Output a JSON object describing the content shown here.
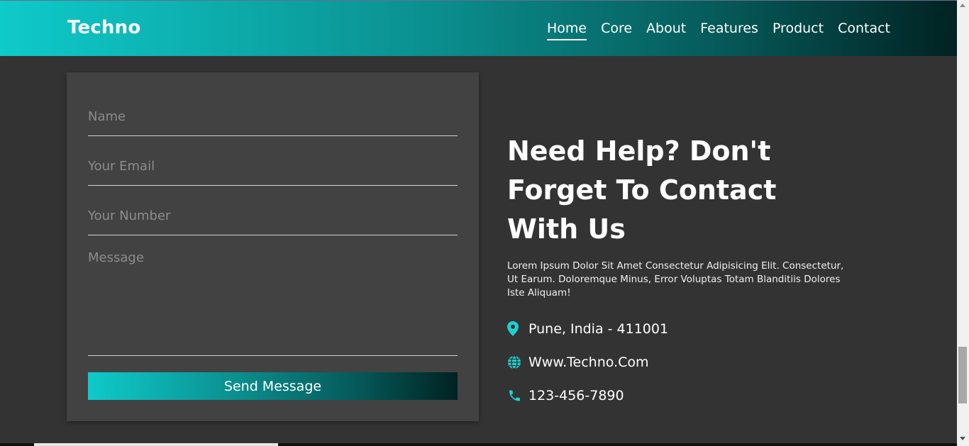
{
  "brand": "Techno",
  "nav": {
    "items": [
      {
        "label": "Home",
        "active": true
      },
      {
        "label": "Core",
        "active": false
      },
      {
        "label": "About",
        "active": false
      },
      {
        "label": "Features",
        "active": false
      },
      {
        "label": "Product",
        "active": false
      },
      {
        "label": "Contact",
        "active": false
      }
    ]
  },
  "form": {
    "name_placeholder": "Name",
    "email_placeholder": "Your Email",
    "number_placeholder": "Your Number",
    "message_placeholder": "Message",
    "name_value": "",
    "email_value": "",
    "number_value": "",
    "message_value": "",
    "send_label": "Send Message"
  },
  "info": {
    "title": "Need Help? Don't Forget To Contact With Us",
    "description": "Lorem Ipsum Dolor Sit Amet Consectetur Adipisicing Elit. Consectetur, Ut Earum. Doloremque Minus, Error Voluptas Totam Blanditiis Dolores Iste Aliquam!",
    "contacts": [
      {
        "icon": "map-pin-icon",
        "text": "Pune, India - 411001"
      },
      {
        "icon": "globe-icon",
        "text": "Www.Techno.Com"
      },
      {
        "icon": "phone-icon",
        "text": "123-456-7890"
      }
    ]
  },
  "colors": {
    "accent": "#0fcaca",
    "accent_dark": "#012222",
    "page_bg": "#333333",
    "card_bg": "#424242",
    "icon": "#1ed1d1"
  }
}
